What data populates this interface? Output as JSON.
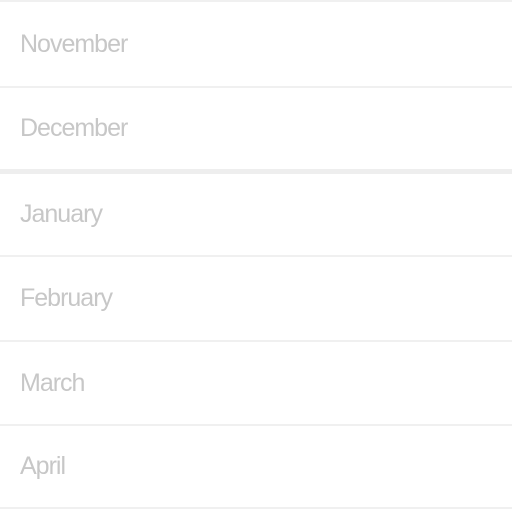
{
  "month_list": {
    "section_before": [
      {
        "label": "November"
      },
      {
        "label": "December"
      }
    ],
    "section_after": [
      {
        "label": "January"
      },
      {
        "label": "February"
      },
      {
        "label": "March"
      },
      {
        "label": "April"
      }
    ]
  }
}
